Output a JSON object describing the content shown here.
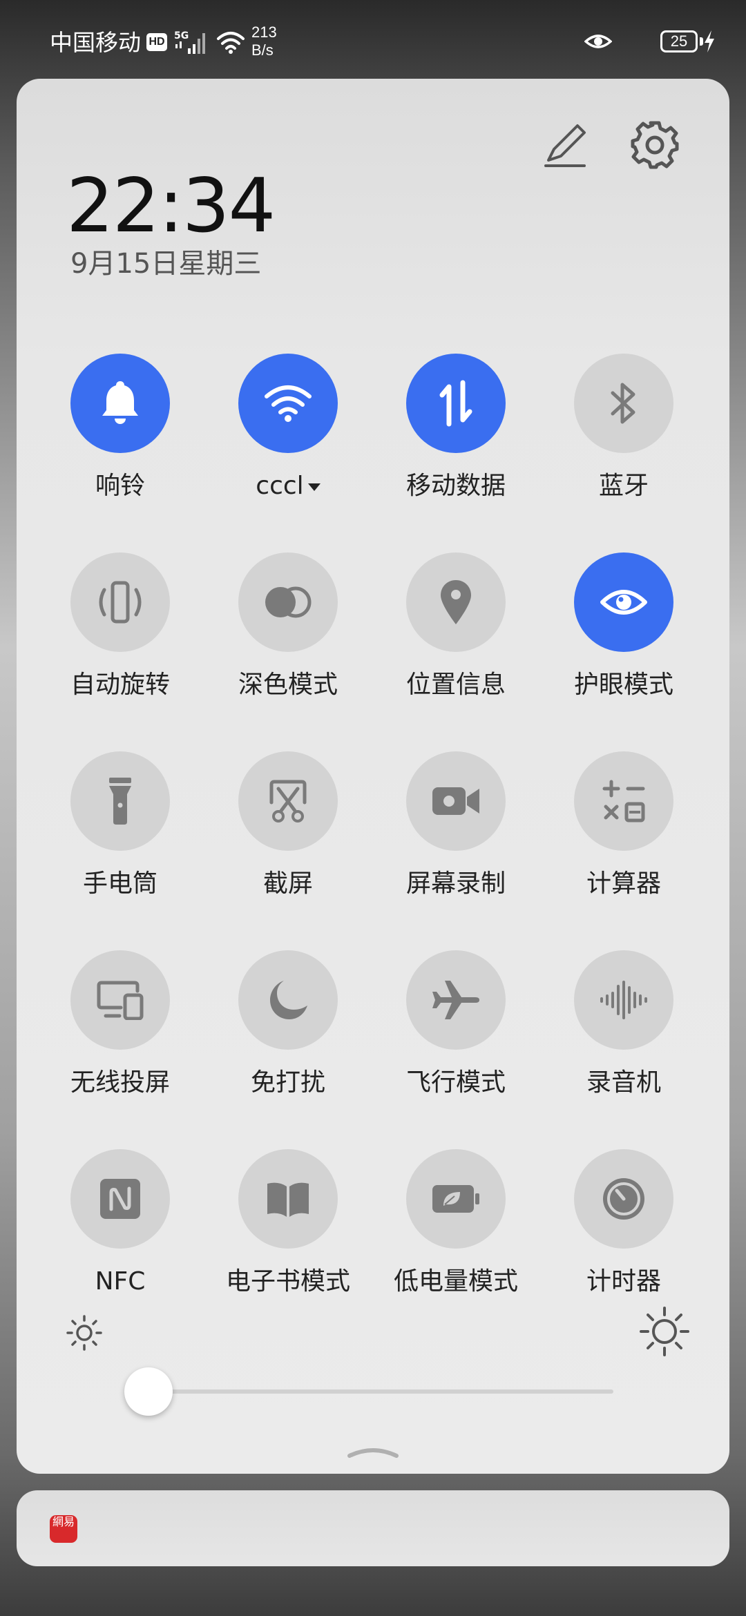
{
  "status_bar": {
    "carrier": "中国移动",
    "hd_badge": "HD",
    "network_type": "5G",
    "speed_value": "213",
    "speed_unit": "B/s",
    "battery_level": "25",
    "icons": [
      "hd-icon",
      "signal-icon",
      "wifi-icon",
      "eye-comfort-icon",
      "battery-icon",
      "charging-icon"
    ]
  },
  "header": {
    "time": "22:34",
    "date": "9月15日星期三",
    "edit_icon": "pencil-icon",
    "settings_icon": "gear-icon"
  },
  "tiles": [
    {
      "id": "ring",
      "label": "响铃",
      "icon": "bell-icon",
      "active": true
    },
    {
      "id": "wifi",
      "label": "cccl",
      "icon": "wifi-icon",
      "active": true,
      "has_dropdown": true
    },
    {
      "id": "mobile-data",
      "label": "移动数据",
      "icon": "data-arrows-icon",
      "active": true
    },
    {
      "id": "bluetooth",
      "label": "蓝牙",
      "icon": "bluetooth-icon",
      "active": false
    },
    {
      "id": "auto-rotate",
      "label": "自动旋转",
      "icon": "rotate-phone-icon",
      "active": false
    },
    {
      "id": "dark-mode",
      "label": "深色模式",
      "icon": "dark-mode-icon",
      "active": false
    },
    {
      "id": "location",
      "label": "位置信息",
      "icon": "location-pin-icon",
      "active": false
    },
    {
      "id": "eye-comfort",
      "label": "护眼模式",
      "icon": "eye-icon",
      "active": true
    },
    {
      "id": "flashlight",
      "label": "手电筒",
      "icon": "flashlight-icon",
      "active": false
    },
    {
      "id": "screenshot",
      "label": "截屏",
      "icon": "scissors-icon",
      "active": false
    },
    {
      "id": "screen-record",
      "label": "屏幕录制",
      "icon": "video-camera-icon",
      "active": false
    },
    {
      "id": "calculator",
      "label": "计算器",
      "icon": "calculator-icon",
      "active": false
    },
    {
      "id": "wireless-projection",
      "label": "无线投屏",
      "icon": "cast-screen-icon",
      "active": false
    },
    {
      "id": "do-not-disturb",
      "label": "免打扰",
      "icon": "moon-icon",
      "active": false
    },
    {
      "id": "airplane-mode",
      "label": "飞行模式",
      "icon": "airplane-icon",
      "active": false
    },
    {
      "id": "recorder",
      "label": "录音机",
      "icon": "sound-wave-icon",
      "active": false
    },
    {
      "id": "nfc",
      "label": "NFC",
      "icon": "nfc-icon",
      "active": false
    },
    {
      "id": "ebook-mode",
      "label": "电子书模式",
      "icon": "book-icon",
      "active": false
    },
    {
      "id": "low-power-mode",
      "label": "低电量模式",
      "icon": "eco-battery-icon",
      "active": false
    },
    {
      "id": "timer",
      "label": "计时器",
      "icon": "timer-icon",
      "active": false
    }
  ],
  "brightness": {
    "level": 0.0,
    "low_icon": "sun-low-icon",
    "high_icon": "sun-high-icon"
  },
  "colors": {
    "active_tile": "#3a6ef0",
    "inactive_tile": "#d3d3d3",
    "icon_gray": "#7a7a7a"
  },
  "notification": {
    "app_icon": "netease-app-icon",
    "app_icon_text": "網易"
  }
}
